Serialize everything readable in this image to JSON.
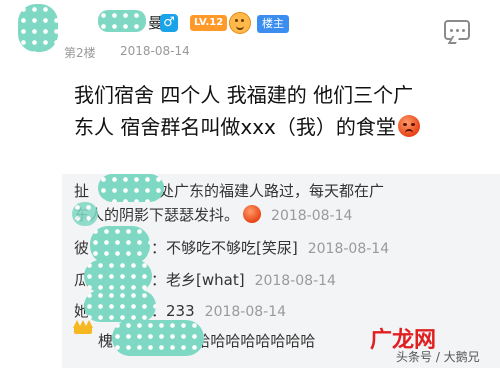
{
  "header": {
    "username_tail": "曼",
    "gender_icon": "♂",
    "level": "LV.12",
    "host_label": "楼主",
    "floor": "第2楼",
    "date": "2018-08-14"
  },
  "post": {
    "lines": [
      "我们宿舍 四个人 我福建的 他们三个广",
      "东人 宿舍群名叫做xxx（我）的食堂"
    ]
  },
  "replies": [
    {
      "prefix": "扯",
      "text_line1": "：身处广东的福建人路过，每天都在广",
      "text_line2_pre": "东人的",
      "text_line2": "阴影下瑟瑟发抖。",
      "date": "2018-08-14"
    },
    {
      "prefix": "彼",
      "text": "：不够吃不够吃[笑尿]",
      "date": "2018-08-14"
    },
    {
      "prefix": "瓜",
      "text": "：老乡[what]",
      "date": "2018-08-14"
    },
    {
      "prefix": "她",
      "text": "：233",
      "date": "2018-08-14"
    },
    {
      "prefix": "槐",
      "text": "-：哈哈哈哈哈哈哈哈",
      "date": ""
    }
  ],
  "watermark": {
    "main": "广龙网",
    "sub": "头条号 / 大鹅兄"
  }
}
